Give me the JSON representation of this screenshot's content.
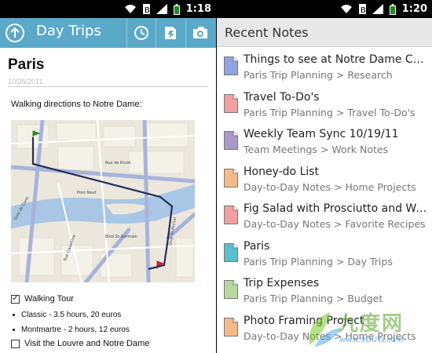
{
  "status_left": {
    "time": "1:18"
  },
  "status_right": {
    "time": "1:20"
  },
  "left": {
    "actionbar": {
      "title": "Day Trips",
      "accent": "#5aa9c9"
    },
    "note": {
      "title": "Paris",
      "date": "10/25/2011",
      "intro": "Walking directions to Notre Dame:",
      "map_labels": [
        "Rue de Rivoli",
        "Quai de Conti",
        "Blvd St-Germain",
        "Rue Dauphine",
        "Quai St-Michel",
        "Pont Neuf"
      ],
      "items": [
        {
          "kind": "checkbox",
          "checked": true,
          "text": "Walking Tour"
        },
        {
          "kind": "bullet",
          "text": "Classic - 3.5 hours, 20 euros"
        },
        {
          "kind": "bullet",
          "text": "Montmartre - 2 hours, 12 euros"
        },
        {
          "kind": "checkbox",
          "checked": false,
          "text": "Visit the Louvre and Notre Dame"
        }
      ]
    }
  },
  "right": {
    "header": "Recent Notes",
    "notes": [
      {
        "name": "Things to see at Notre Dame Cat...",
        "path": "Paris Trip Planning > Research",
        "color": "#8fa3e0"
      },
      {
        "name": "Travel To-Do's",
        "path": "Paris Trip Planning > Travel To-Do's",
        "color": "#f0a0a0"
      },
      {
        "name": "Weekly Team Sync 10/19/11",
        "path": "Team Meetings > Work Notes",
        "color": "#a898c8"
      },
      {
        "name": "Honey-do List",
        "path": "Day-to-Day Notes > Home Projects",
        "color": "#f5b98a"
      },
      {
        "name": "Fig Salad with Prosciutto and Wa...",
        "path": "Day-to-Day Notes > Favorite Recipes",
        "color": "#f0a0a0"
      },
      {
        "name": "Paris",
        "path": "Paris Trip Planning > Day Trips",
        "color": "#5bc0cc"
      },
      {
        "name": "Trip Expenses",
        "path": "Paris Trip Planning > Budget",
        "color": "#b8d8a0"
      },
      {
        "name": "Photo Framing Project",
        "path": "Day-to-Day Notes > Home Projects",
        "color": "#f5b98a"
      }
    ]
  },
  "watermark": {
    "text": "九度网",
    "url": "www.9DUW.com"
  }
}
